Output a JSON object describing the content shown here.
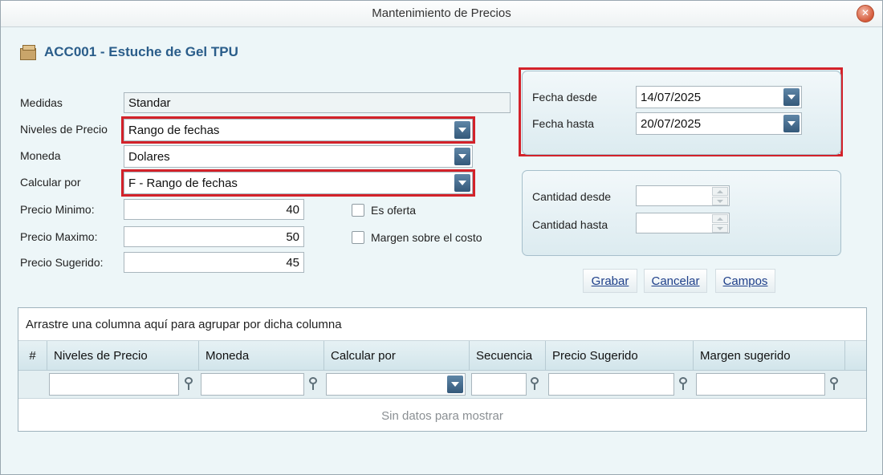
{
  "window": {
    "title": "Mantenimiento de Precios",
    "close_glyph": "✕"
  },
  "product": {
    "title": "ACC001 - Estuche de Gel TPU",
    "icon": "box-icon"
  },
  "form": {
    "medidas": {
      "label": "Medidas",
      "value": "Standar"
    },
    "niveles": {
      "label": "Niveles de Precio",
      "value": "Rango de fechas"
    },
    "moneda": {
      "label": "Moneda",
      "value": "Dolares"
    },
    "calcular": {
      "label": "Calcular por",
      "value": "F - Rango de fechas"
    },
    "precio_minimo": {
      "label": "Precio Minimo:",
      "value": "40"
    },
    "precio_maximo": {
      "label": "Precio Maximo:",
      "value": "50"
    },
    "precio_sugerido": {
      "label": "Precio Sugerido:",
      "value": "45"
    },
    "es_oferta": {
      "label": "Es oferta",
      "checked": false
    },
    "margen_costo": {
      "label": "Margen sobre el costo",
      "checked": false
    }
  },
  "dates": {
    "desde": {
      "label": "Fecha desde",
      "value": "14/07/2025"
    },
    "hasta": {
      "label": "Fecha hasta",
      "value": "20/07/2025"
    }
  },
  "quantity": {
    "desde": {
      "label": "Cantidad desde",
      "value": ""
    },
    "hasta": {
      "label": "Cantidad hasta",
      "value": ""
    }
  },
  "buttons": {
    "grabar": "Grabar",
    "cancelar": "Cancelar",
    "campos": "Campos"
  },
  "grid": {
    "group_hint": "Arrastre una columna aquí para agrupar por dicha columna",
    "columns": [
      "#",
      "Niveles de Precio",
      "Moneda",
      "Calcular por",
      "Secuencia",
      "Precio Sugerido",
      "Margen sugerido"
    ],
    "empty_text": "Sin datos para mostrar"
  },
  "colors": {
    "accent": "#2a5d8a",
    "highlight": "#d3222a",
    "link": "#1e3f8a"
  }
}
